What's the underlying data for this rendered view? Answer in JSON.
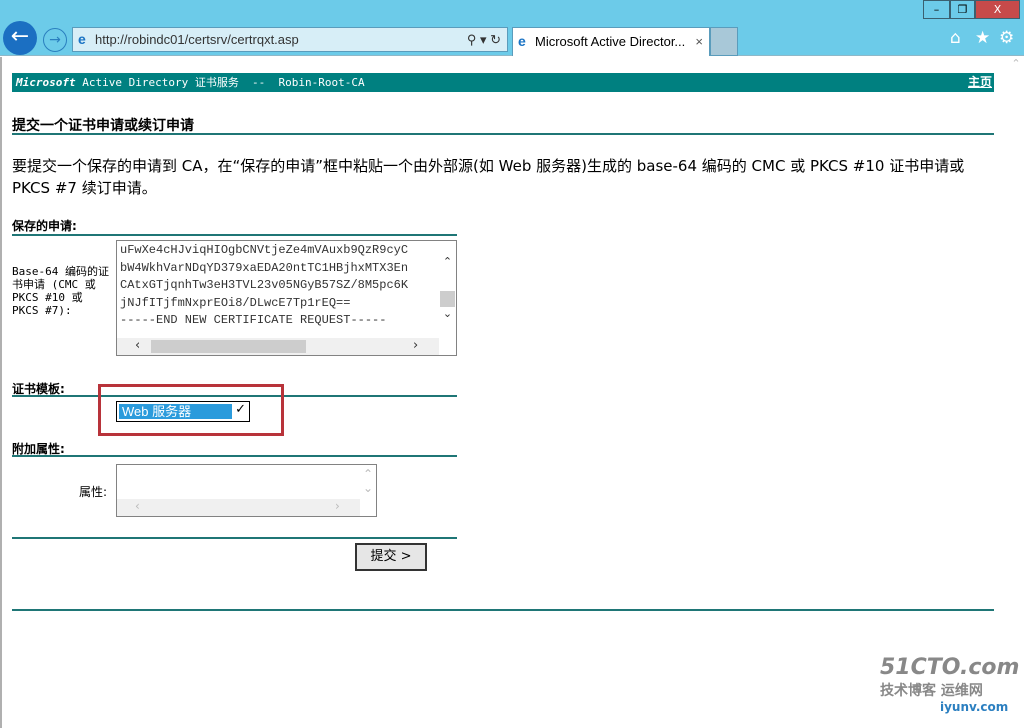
{
  "browser": {
    "url": "http://robindc01/certsrv/certrqxt.asp",
    "tab_title": "Microsoft Active Director...",
    "window": {
      "minimize": "–",
      "restore": "❐",
      "close": "X"
    }
  },
  "header": {
    "brand": "Microsoft",
    "title": " Active Directory 证书服务  --  Robin-Root-CA",
    "home_link": "主页"
  },
  "page": {
    "title": "提交一个证书申请或续订申请",
    "description": "要提交一个保存的申请到 CA，在“保存的申请”框中粘贴一个由外部源(如 Web 服务器)生成的 base-64 编码的 CMC 或 PKCS #10 证书申请或 PKCS #7 续订申请。"
  },
  "saved_request": {
    "section": "保存的申请:",
    "label": "Base-64 编码的证书申请 (CMC 或 PKCS #10 或 PKCS #7):",
    "value": "uFwXe4cHJviqHIOgbCNVtjeZe4mVAuxb9QzR9cyC\nbW4WkhVarNDqYD379xaEDA20ntTC1HBjhxMTX3En\nCAtxGTjqnhTw3eH3TVL23v05NGyB57SZ/8M5pc6K\njNJfITjfmNxprEOi8/DLwcE7Tp1rEQ==\n-----END NEW CERTIFICATE REQUEST-----"
  },
  "template": {
    "section": "证书模板:",
    "selected": "Web 服务器"
  },
  "attributes": {
    "section": "附加属性:",
    "label": "属性:",
    "value": ""
  },
  "submit_label": "提交 >",
  "watermark": {
    "line1": "51CTO.com",
    "line2": "技术博客 运维网",
    "line3": "iyunv.com"
  },
  "colors": {
    "teal": "#008080",
    "highlight": "#b8333a",
    "select": "#2b9bdc"
  }
}
